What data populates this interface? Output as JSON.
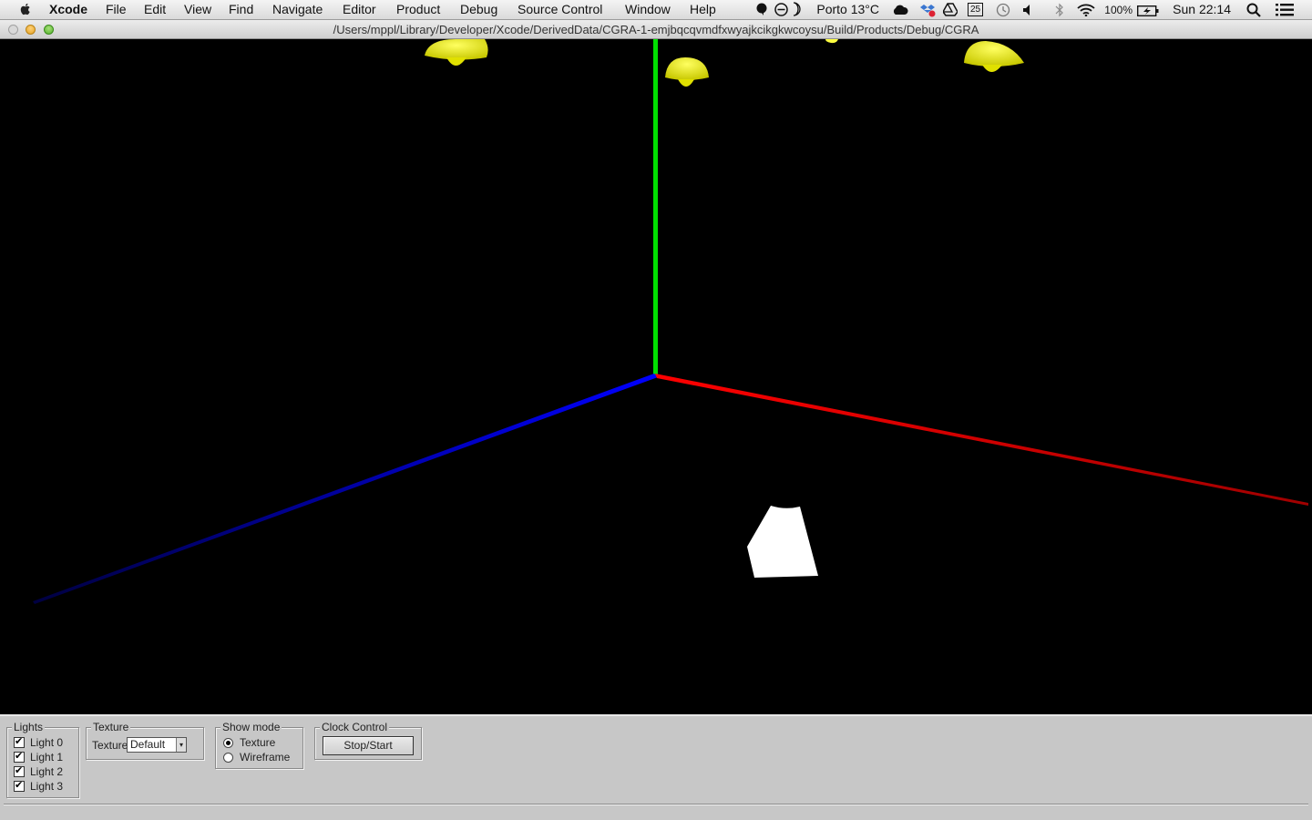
{
  "menubar": {
    "app_name": "Xcode",
    "items": [
      "File",
      "Edit",
      "View",
      "Find",
      "Navigate",
      "Editor",
      "Product",
      "Debug",
      "Source Control",
      "Window",
      "Help"
    ],
    "weather": "Porto 13°C",
    "calendar_day": "25",
    "battery": "100%",
    "clock": "Sun 22:14"
  },
  "window": {
    "title": "/Users/mppl/Library/Developer/Xcode/DerivedData/CGRA-1-emjbqcqvmdfxwyajkcikgkwcoysu/Build/Products/Debug/CGRA"
  },
  "scene": {
    "axis_colors": {
      "x": "#ff0000",
      "y": "#00e000",
      "z": "#0000ff"
    },
    "lamp_color": "#ffff00",
    "object_color": "#ffffff"
  },
  "panel": {
    "lights": {
      "title": "Lights",
      "items": [
        {
          "label": "Light 0",
          "checked": true
        },
        {
          "label": "Light 1",
          "checked": true
        },
        {
          "label": "Light 2",
          "checked": true
        },
        {
          "label": "Light 3",
          "checked": true
        }
      ]
    },
    "texture": {
      "title": "Texture",
      "label": "Texture",
      "selected": "Default"
    },
    "show_mode": {
      "title": "Show mode",
      "options": [
        {
          "label": "Texture",
          "selected": true
        },
        {
          "label": "Wireframe",
          "selected": false
        }
      ]
    },
    "clock": {
      "title": "Clock Control",
      "button": "Stop/Start"
    }
  }
}
